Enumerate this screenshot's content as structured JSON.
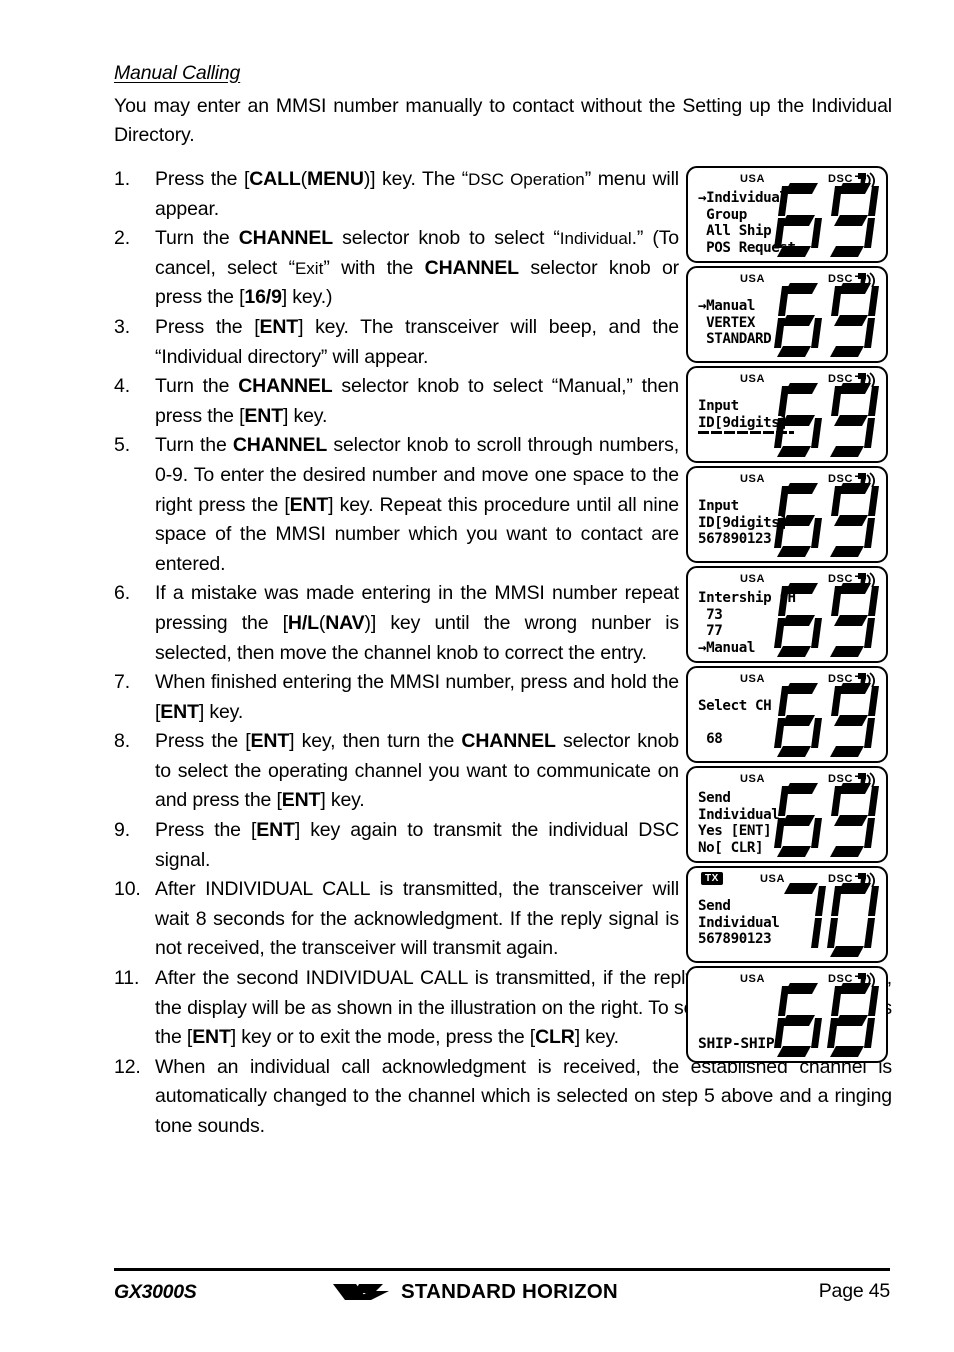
{
  "document": {
    "section_heading": "Manual Calling",
    "intro": "You may enter an MMSI number manually to contact without the Setting up the Individual Directory.",
    "steps": [
      {
        "num": "1.",
        "html": "Press the [<b>CALL</b>(<b>MENU</b>)] key. The “<span class=\"sm\">DSC Operation</span>” menu will appear."
      },
      {
        "num": "2.",
        "html": "Turn the <b>CHANNEL</b> selector knob to select “<span class=\"sm\">Individual</span>.” (To cancel, select “<span class=\"sm\">Exit</span>” with the <b>CHANNEL</b> selector knob or press the [<b>16/9</b>] key.)"
      },
      {
        "num": "3.",
        "html": "Press the [<b>ENT</b>] key. The transceiver will beep, and the “Individual directory” will appear."
      },
      {
        "num": "4.",
        "html": "Turn the <b>CHANNEL</b> selector knob to select “Manual,” then press the [<b>ENT</b>] key."
      },
      {
        "num": "5.",
        "html": "Turn the <b>CHANNEL</b> selector knob to scroll through numbers, 0-9. To enter the desired number and move one space to the right press the [<b>ENT</b>] key. Repeat this procedure until all nine space of the MMSI number which you want to contact are entered."
      },
      {
        "num": "6.",
        "html": "If a mistake was made entering in the MMSI number repeat pressing the [<b>H/L</b>(<b>NAV</b>)] key until the wrong nunber is selected, then move the channel knob to correct the entry."
      },
      {
        "num": "7.",
        "html": "When finished entering the MMSI number, press and hold the [<b>ENT</b>] key."
      },
      {
        "num": "8.",
        "html": "Press the [<b>ENT</b>] key, then turn the <b>CHANNEL</b> selector knob to select the operating channel you want to communicate on and press the [<b>ENT</b>] key."
      },
      {
        "num": "9.",
        "html": "Press the [<b>ENT</b>] key again to transmit the individual DSC signal."
      },
      {
        "num": "10.",
        "html": "After INDIVIDUAL CALL is transmitted, the transceiver will wait 8 seconds for the acknowledgment. If the reply signal is not received, the transceiver will transmit again."
      },
      {
        "num": "11.",
        "html": "After the second INDIVIDUAL CALL is transmitted, if the reply signal is not received, the display will be as shown in the illustration on the right. To send the call again, press the [<b>ENT</b>] key or to exit the mode, press the [<b>CLR</b>] key."
      },
      {
        "num": "12.",
        "html": "When an individual call acknowledgment is received, the established channel is automatically changed to the channel which is selected on step 5 above and a ringing tone sounds."
      }
    ]
  },
  "lcd_panels": [
    {
      "usa_label": "USA",
      "dsc_label": "DSC",
      "tx_label": null,
      "lines": [
        "→Individual",
        " Group",
        " All Ship",
        " POS Request"
      ],
      "bottom_left": null,
      "dashes": false,
      "channel": "69"
    },
    {
      "usa_label": "USA",
      "dsc_label": "DSC",
      "tx_label": null,
      "lines": [
        "→Manual",
        " VERTEX",
        " STANDARD"
      ],
      "bottom_left": null,
      "dashes": false,
      "channel": "69"
    },
    {
      "usa_label": "USA",
      "dsc_label": "DSC",
      "tx_label": null,
      "lines": [
        "Input",
        "ID[9digits]"
      ],
      "bottom_left": null,
      "dashes": true,
      "channel": "69"
    },
    {
      "usa_label": "USA",
      "dsc_label": "DSC",
      "tx_label": null,
      "lines": [
        "Input",
        "ID[9digits]",
        "567890123"
      ],
      "bottom_left": null,
      "dashes": false,
      "channel": "69"
    },
    {
      "usa_label": "USA",
      "dsc_label": "DSC",
      "tx_label": null,
      "lines": [
        "Intership CH",
        " 73",
        " 77",
        "→Manual"
      ],
      "bottom_left": null,
      "dashes": false,
      "channel": "69"
    },
    {
      "usa_label": "USA",
      "dsc_label": "DSC",
      "tx_label": null,
      "lines": [
        "Select CH",
        "",
        " 68"
      ],
      "bottom_left": null,
      "dashes": false,
      "channel": "69"
    },
    {
      "usa_label": "USA",
      "dsc_label": "DSC",
      "tx_label": null,
      "lines": [
        "Send",
        "Individual",
        "Yes [ENT]",
        "No[ CLR]"
      ],
      "bottom_left": null,
      "dashes": false,
      "channel": "69"
    },
    {
      "usa_label": "USA",
      "dsc_label": "DSC",
      "tx_label": "TX",
      "lines": [
        "Send",
        "Individual",
        "567890123"
      ],
      "bottom_left": null,
      "dashes": false,
      "channel": "70"
    },
    {
      "usa_label": "USA",
      "dsc_label": "DSC",
      "tx_label": null,
      "lines": [],
      "bottom_left": "SHIP-SHIP",
      "dashes": false,
      "channel": "68"
    }
  ],
  "footer": {
    "model": "GX3000S",
    "brand_first": "STANDARD",
    "brand_second": "HORIZON",
    "page_label": "Page 45"
  }
}
